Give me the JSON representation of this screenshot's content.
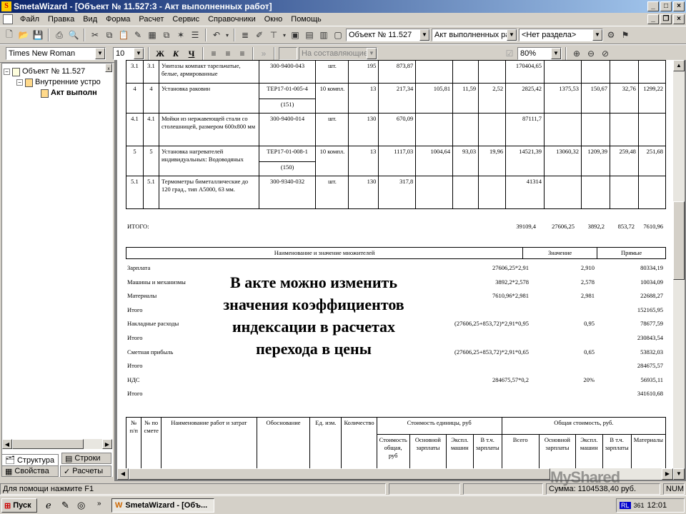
{
  "window": {
    "title": "SmetaWizard - [Объект № 11.527:3 - Акт выполненных работ]",
    "app_icon": "S"
  },
  "menu": [
    "Файл",
    "Правка",
    "Вид",
    "Форма",
    "Расчет",
    "Сервис",
    "Справочники",
    "Окно",
    "Помощь"
  ],
  "toolbar1": {
    "object_combo": "Объект № 11.527",
    "doc_combo": "Акт выполненных ра",
    "section_combo": "<Нет раздела>"
  },
  "toolbar2": {
    "font": "Times New Roman",
    "size": "10",
    "bold": "Ж",
    "italic": "К",
    "underline": "Ч",
    "composite": "На составляющие",
    "zoom": "80%"
  },
  "tree": {
    "root": "Объект № 11.527",
    "child": "Внутренние устро",
    "leaf": "Акт выполн"
  },
  "tabs": {
    "structure": "Структура",
    "rows": "Строки",
    "properties": "Свойства",
    "calcs": "Расчеты"
  },
  "rows": [
    {
      "n1": "3.1",
      "n2": "3.1",
      "name": "Унитазы компакт тарельчатые, белые, армированные",
      "code": "300-9400-043",
      "unit": "шт.",
      "qty": "195",
      "price": "873,87",
      "salary": "",
      "mach": "",
      "machsal": "",
      "total": "170404,65",
      "tsal": "",
      "tmach": "",
      "tmsal": "",
      "tmat": ""
    },
    {
      "n1": "4",
      "n2": "4",
      "name": "Установка раковин",
      "code": "ТЕР17-01-005-4",
      "code2": "(151)",
      "unit": "10 компл.",
      "qty": "13",
      "price": "217,34",
      "salary": "105,81",
      "mach": "11,59",
      "machsal": "2,52",
      "total": "2825,42",
      "tsal": "1375,53",
      "tmach": "150,67",
      "tmsal": "32,76",
      "tmat": "1299,22"
    },
    {
      "n1": "4.1",
      "n2": "4.1",
      "name": "Мойки из нержавеющей стали со столешницей, размером 600х800 мм",
      "code": "300-9400-014",
      "unit": "шт.",
      "qty": "130",
      "price": "670,09",
      "salary": "",
      "mach": "",
      "machsal": "",
      "total": "87111,7",
      "tsal": "",
      "tmach": "",
      "tmsal": "",
      "tmat": ""
    },
    {
      "n1": "5",
      "n2": "5",
      "name": "Установка нагревателей индивидуальных: Водоводяных",
      "code": "ТЕР17-01-008-1",
      "code2": "(150)",
      "unit": "10 компл.",
      "qty": "13",
      "price": "1117,03",
      "salary": "1004,64",
      "mach": "93,03",
      "machsal": "19,96",
      "total": "14521,39",
      "tsal": "13060,32",
      "tmach": "1209,39",
      "tmsal": "259,48",
      "tmat": "251,68"
    },
    {
      "n1": "5.1",
      "n2": "5.1",
      "name": "Термометры биметаллические до 120 град., тип А5000, 63 мм.",
      "code": "300-9340-032",
      "unit": "шт.",
      "qty": "130",
      "price": "317,8",
      "salary": "",
      "mach": "",
      "machsal": "",
      "total": "41314",
      "tsal": "",
      "tmach": "",
      "tmsal": "",
      "tmat": ""
    }
  ],
  "itogo": {
    "label": "ИТОГО:",
    "total": "39109,4",
    "tsal": "27606,25",
    "tmach": "3892,2",
    "tmsal": "853,72",
    "tmat": "7610,96"
  },
  "coef_header": {
    "name": "Наименование и значение множителей",
    "value": "Значение",
    "direct": "Прямые"
  },
  "coefs": [
    {
      "label": "Зарплата",
      "formula": "27606,25*2,91",
      "value": "2,910",
      "direct": "80334,19"
    },
    {
      "label": "Машины и механизмы",
      "formula": "3892,2*2,578",
      "value": "2,578",
      "direct": "10034,09"
    },
    {
      "label": "Материалы",
      "formula": "7610,96*2,981",
      "value": "2,981",
      "direct": "22688,27"
    },
    {
      "label": "Итого",
      "formula": "",
      "value": "",
      "direct": "152165,95"
    },
    {
      "label": "Накладные расходы",
      "formula": "(27606,25+853,72)*2,91*0,95",
      "value": "0,95",
      "direct": "78677,59"
    },
    {
      "label": "Итого",
      "formula": "",
      "value": "",
      "direct": "230843,54"
    },
    {
      "label": "Сметная прибыль",
      "formula": "(27606,25+853,72)*2,91*0,65",
      "value": "0,65",
      "direct": "53832,03"
    },
    {
      "label": "Итого",
      "formula": "",
      "value": "",
      "direct": "284675,57"
    },
    {
      "label": "НДС",
      "formula": "284675,57*0,2",
      "value": "20%",
      "direct": "56935,11"
    },
    {
      "label": "Итого",
      "formula": "",
      "value": "",
      "direct": "341610,68"
    }
  ],
  "overlay_text": [
    "В акте можно изменить",
    "значения коэффициентов",
    "индексации в расчетах",
    "перехода в цены"
  ],
  "t2": {
    "np": "№ п/п",
    "npos": "№ по смете",
    "name": "Наименование работ и затрат",
    "basis": "Обоснование",
    "unit": "Ед. изм.",
    "qty": "Количество",
    "unitcost": "Стоимость единицы, руб",
    "totalcost": "Общая стоимость, руб.",
    "c1": "Стоимость общая, руб",
    "c2": "Основной зарплаты",
    "c3": "Экспл. машин",
    "c4": "В т.ч. зарплаты",
    "c5": "Всего",
    "c6": "Основной зарплаты",
    "c7": "Экспл. машин",
    "c8": "В т.ч. зарплаты",
    "c9": "Материалы"
  },
  "status": {
    "help": "Для помощи нажмите F1",
    "sum": "Сумма: 1104538,40 руб.",
    "num": "NUM"
  },
  "taskbar": {
    "start": "Пуск",
    "task": "SmetaWizard - [Объ...",
    "lang": "RL",
    "count": "361",
    "time": "12:01"
  },
  "watermark": "MyShared"
}
